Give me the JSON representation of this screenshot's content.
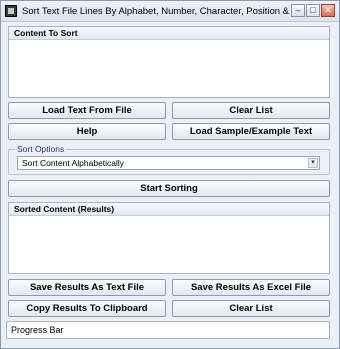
{
  "window": {
    "title": "Sort Text File Lines By Alphabet, Number, Character, Position & Length So...",
    "minimize_glyph": "–",
    "maximize_glyph": "□",
    "close_glyph": "✕",
    "icon": "app-icon"
  },
  "content_panel": {
    "label": "Content To Sort"
  },
  "buttons": {
    "load_file": "Load Text From File",
    "clear_list_top": "Clear List",
    "help": "Help",
    "load_sample": "Load Sample/Example Text",
    "start_sorting": "Start Sorting",
    "save_text": "Save Results As Text File",
    "save_excel": "Save Results As Excel File",
    "copy_clipboard": "Copy Results To Clipboard",
    "clear_list_bottom": "Clear List"
  },
  "sort_options": {
    "legend": "Sort Options",
    "selected": "Sort Content Alphabetically",
    "arrow_glyph": "▾"
  },
  "results_panel": {
    "label": "Sorted Content (Results)"
  },
  "status": {
    "progress_label": "Progress Bar"
  }
}
